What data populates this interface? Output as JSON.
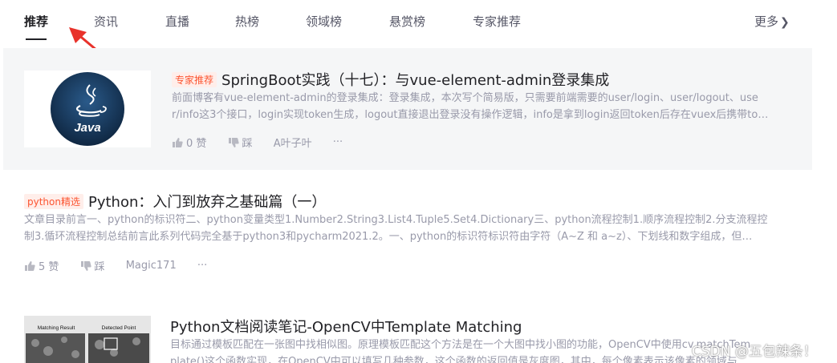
{
  "tabs": {
    "items": [
      "推荐",
      "资讯",
      "直播",
      "热榜",
      "领域榜",
      "悬赏榜",
      "专家推荐"
    ],
    "active": "推荐",
    "more_label": "更多"
  },
  "articles": [
    {
      "tag": "专家推荐",
      "title": "SpringBoot实践（十七）：与vue-element-admin登录集成",
      "summary_line1": "前面博客有vue-element-admin的登录集成：登录集成，本次写个简易版，只需要前端需要的user/login、user/logout、use",
      "summary_line2": "r/info这3个接口，login实现token生成，logout直接退出登录没有操作逻辑，info是拿到login返回token后存在vuex后携带to…",
      "likes": "0 赞",
      "dislike": "踩",
      "author": "A叶子叶",
      "more": "···",
      "thumb_label": "Java"
    },
    {
      "tag": "python精选",
      "title": "Python：入门到放弃之基础篇（一）",
      "summary_line1": "文章目录前言一、python的标识符二、python变量类型1.Number2.String3.List4.Tuple5.Set4.Dictionary三、python流程控制1.顺序流程控制2.分支流程控",
      "summary_line2": "制3.循环流程控制总结前言此系列代码完全基于python3和pycharm2021.2。一、python的标识符标识符由字符（A~Z 和 a~z）、下划线和数字组成，但…",
      "likes": "5 赞",
      "dislike": "踩",
      "author": "Magic171",
      "more": "···"
    },
    {
      "title": "Python文档阅读笔记-OpenCV中Template Matching",
      "summary_line1": "目标通过模板匹配在一张图中找相似图。原理模板匹配这个方法是在一个大图中找小图的功能，OpenCV中使用cv.matchTem",
      "summary_line2": "plate()这个函数实现，在OpenCV中可以填写几种参数，这个函数的返回值是灰度图，其中，每个像素表示该像素的领域与…",
      "thumb_caption_left": "Matching Result",
      "thumb_caption_right": "Detected Point"
    }
  ],
  "watermark": "CSDN @五包辣条！",
  "colors": {
    "accent_red": "#fc5531",
    "arrow_red": "#e8322b",
    "java_circle": "#1c3a5e"
  }
}
